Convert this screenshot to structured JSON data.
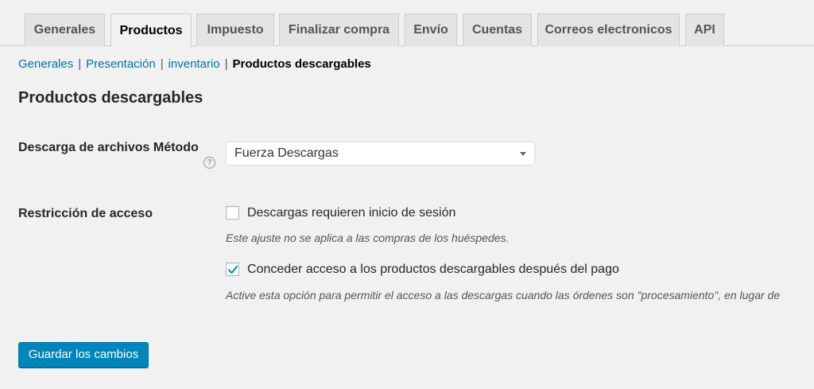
{
  "tabs": [
    {
      "label": "Generales",
      "active": false
    },
    {
      "label": "Productos",
      "active": true
    },
    {
      "label": "Impuesto",
      "active": false
    },
    {
      "label": "Finalizar compra",
      "active": false
    },
    {
      "label": "Envío",
      "active": false
    },
    {
      "label": "Cuentas",
      "active": false
    },
    {
      "label": "Correos electronicos",
      "active": false
    },
    {
      "label": "API",
      "active": false
    }
  ],
  "subnav": {
    "links": [
      "Generales",
      "Presentación",
      "inventario"
    ],
    "separator": "|",
    "current": "Productos descargables"
  },
  "section": {
    "title": "Productos descargables"
  },
  "download_method": {
    "label": "Descarga de archivos Método",
    "help_glyph": "?",
    "selected": "Fuerza Descargas"
  },
  "access": {
    "label": "Restricción de acceso",
    "require_login": {
      "label": "Descargas requieren inicio de sesión",
      "checked": false,
      "description": "Este ajuste no se aplica a las compras de los huéspedes."
    },
    "grant_access": {
      "label": "Conceder acceso a los productos descargables después del pago",
      "checked": true,
      "description": "Active esta opción para permitir el acceso a las descargas cuando las órdenes son \"procesamiento\", en lugar de"
    }
  },
  "save_button": {
    "label": "Guardar los cambios"
  },
  "colors": {
    "accent": "#0085ba",
    "link": "#0073aa",
    "background": "#f1f1f1",
    "check": "#1e8cbe"
  }
}
